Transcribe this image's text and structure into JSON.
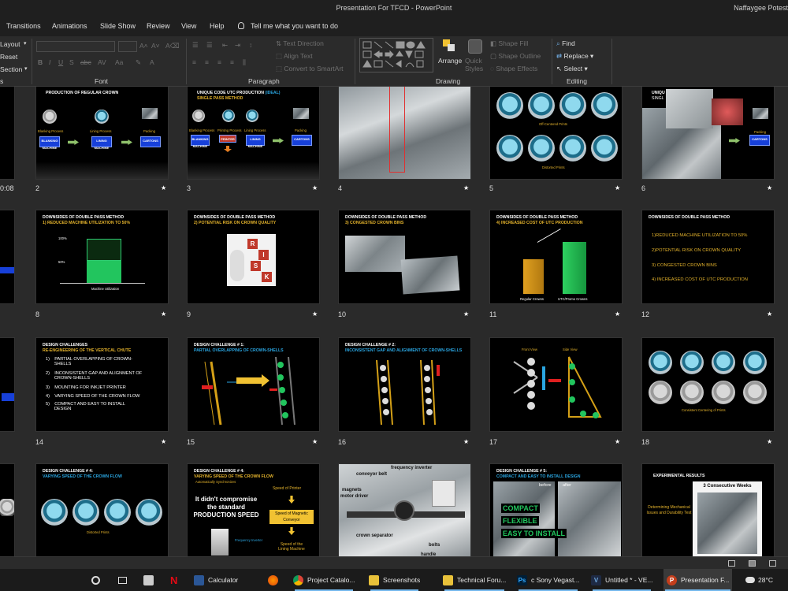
{
  "window": {
    "title": "Presentation For TFCD  -  PowerPoint",
    "user": "Naffaygee Potest"
  },
  "ribbon_tabs": [
    "Transitions",
    "Animations",
    "Slide Show",
    "Review",
    "View",
    "Help"
  ],
  "tell_me": "Tell me what you want to do",
  "slides_group": {
    "layout": "Layout",
    "reset": "Reset",
    "section": "Section"
  },
  "groups": {
    "font": "Font",
    "paragraph": "Paragraph",
    "drawing": "Drawing",
    "editing": "Editing"
  },
  "paragraph": {
    "text_direction": "Text Direction",
    "align_text": "Align Text",
    "convert_smartart": "Convert to SmartArt"
  },
  "drawing": {
    "arrange": "Arrange",
    "quick_styles": "Quick Styles",
    "shape_fill": "Shape Fill",
    "shape_outline": "Shape Outline",
    "shape_effects": "Shape Effects"
  },
  "editing": {
    "find": "Find",
    "replace": "Replace",
    "select": "Select"
  },
  "slides": [
    {
      "num": "2",
      "t1": "PRODUCTION OF REGULAR CROWN",
      "labels": [
        "Blanking Process",
        "Lining Process",
        "Packing"
      ],
      "boxes": [
        "BLANKING MACHINE",
        "LINING MACHINE",
        "CARTONS"
      ]
    },
    {
      "num": "3",
      "t1": "UNIQUE CODE UTC PRODUCTION",
      "t1b": "(IDEAL)",
      "t2": "SINGLE PASS METHOD",
      "labels": [
        "Blanking Process",
        "Printing Process",
        "Lining Process",
        "Packing"
      ],
      "boxes": [
        "BLANKING MACHINE",
        "PRINTER",
        "LINING MACHINE",
        "CARTONS"
      ]
    },
    {
      "num": "4"
    },
    {
      "num": "5",
      "caption1": "Off-Centered Prints",
      "caption2": "Distorted Prints"
    },
    {
      "num": "6",
      "t1": "UNIQU",
      "t2": "SINGL",
      "box": "CARTONS",
      "label": "Packing"
    },
    {
      "num": "8",
      "t1": "DOWNSIDES OF DOUBLE PASS METHOD",
      "t2": "1)  REDUCED MACHINE UTILIZATION TO 50%",
      "y1": "100%",
      "y2": "50%",
      "xlabel": "Machine Utilization"
    },
    {
      "num": "9",
      "t1": "DOWNSIDES OF DOUBLE PASS METHOD",
      "t2": "2)  POTENTIAL RISK ON CROWN QUALITY",
      "risk": [
        "R",
        "I",
        "S",
        "K"
      ]
    },
    {
      "num": "10",
      "t1": "DOWNSIDES OF DOUBLE PASS METHOD",
      "t2": "3)  CONGESTED CROWN BINS"
    },
    {
      "num": "11",
      "t1": "DOWNSIDES OF DOUBLE PASS METHOD",
      "t2": "4)  INCREASED COST OF UTC PRODUCTION",
      "bars": [
        "Regular Crowns",
        "UTC/Promo Crowns"
      ]
    },
    {
      "num": "12",
      "t1": "DOWNSIDES OF DOUBLE PASS METHOD",
      "items": [
        "1)REDUCED MACHINE UTILIZATION TO 50%",
        "2)POTENTIAL RISK ON CROWN QUALITY",
        "3)  CONGESTED CROWN BINS",
        "4) INCREASED COST OF UTC PRODUCTION"
      ]
    },
    {
      "num": "14",
      "t1": "DESIGN CHALLENGES",
      "t2": "RE-ENGINEERING OF THE VERTICAL CHUTE",
      "items": [
        "1)    PARTIAL OVERLAPPING OF CROWN-\n       SHELLS",
        "2)    INCONSISTENT GAP AND ALIGNMENT OF\n       CROWN-SHELLS",
        "3)    MOUNTING FOR INKJET PRINTER",
        "4)    VARYING SPEED OF THE CROWN FLOW",
        "5)    COMPACT AND EASY TO INSTALL\n       DESIGN"
      ]
    },
    {
      "num": "15",
      "t1": "DESIGN CHALLENGE # 1:",
      "t2": "PARTIAL OVERLAPPING OF CROWN-SHELLS"
    },
    {
      "num": "16",
      "t1": "DESIGN CHALLENGE # 2:",
      "t2": "INCONSISTENT GAP AND ALIGNMENT OF CROWN-SHELLS"
    },
    {
      "num": "17",
      "labels": [
        "Front View",
        "Side View"
      ]
    },
    {
      "num": "18",
      "caption": "Consistent Centering of Prints"
    },
    {
      "num": "",
      "t1": "DESIGN CHALLENGE # 4:",
      "t2": "VARYING SPEED OF THE CROWN FLOW",
      "caption": "Distorted Prints"
    },
    {
      "num": "",
      "t1": "DESIGN CHALLENGE # 4:",
      "t2": "VARYING SPEED OF THE CROWN FLOW",
      "t3": "Automatically Synchronizes",
      "big": "It didn't compromise the standard PRODUCTION SPEED",
      "boxes": [
        "Speed of Printer",
        "Speed of Magnetic Conveyor",
        "Speed of the Lining Machine"
      ],
      "label": "Frequency Inverter"
    },
    {
      "num": "",
      "labels": [
        "conveyor belt",
        "frequency inverter",
        "magnets",
        "motor driver",
        "crown separator",
        "bolts",
        "handle"
      ]
    },
    {
      "num": "",
      "t1": "DESIGN CHALLENGE # 5:",
      "t2": "COMPACT AND EASY TO INSTALL DESIGN",
      "labels": [
        "before",
        "after"
      ],
      "words": [
        "COMPACT",
        "FLEXIBLE",
        "EASY TO INSTALL"
      ]
    },
    {
      "num": "",
      "t1": "EXPERIMENTAL RESULTS",
      "caption": "3 Consecutive Weeks",
      "side": "Determining Mechanical Issues and Durability Test"
    }
  ],
  "partial_left": {
    "time": "0:08"
  },
  "status": {
    "icons": [
      "normal-view",
      "slide-sorter-view",
      "reading-view"
    ]
  },
  "taskbar": {
    "items": [
      {
        "name": "Calculator",
        "color": "#2b5797"
      },
      {
        "name": "Project Catalo...",
        "color": "#e8a33a"
      },
      {
        "name": "Screenshots",
        "color": "#e8c13a"
      },
      {
        "name": "Technical Foru...",
        "color": "#e8c13a"
      },
      {
        "name": "c Sony Vegast...",
        "color": "#2c8fd8"
      },
      {
        "name": "Untitled * - VE...",
        "color": "#3a6ee8"
      },
      {
        "name": "Presentation F...",
        "color": "#c43e1c"
      }
    ],
    "temperature": "28°C"
  }
}
